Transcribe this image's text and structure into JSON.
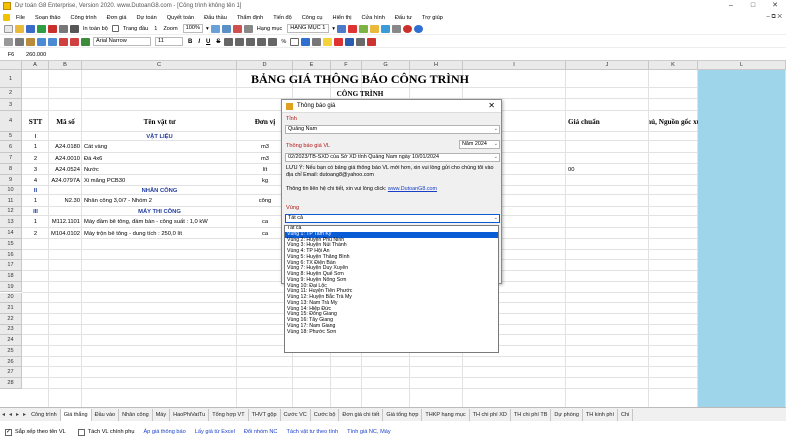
{
  "window": {
    "title": "Dự toán G8 Enterprise, Version 2020.  www.DutoanG8.com - [Công trình không tên 1]",
    "controls": [
      "–",
      "□",
      "✕"
    ]
  },
  "menu": {
    "items": [
      "File",
      "Soạn thảo",
      "Công trình",
      "Đơn giá",
      "Dự toán",
      "Quyết toán",
      "Đấu thầu",
      "Thẩm định",
      "Tiến độ",
      "Công cụ",
      "Hiển thị",
      "Cửa hình",
      "Đấu tư",
      "Trợ giúp"
    ],
    "right_controls": "–  ⧉  ✕"
  },
  "toolbar1": {
    "print_all": "In toàn bộ",
    "page_label": "Trang đầu",
    "page_value": "1",
    "zoom_label": "Zoom",
    "zoom_value": "100%",
    "category_label": "Hạng mục",
    "category_value": "HẠNG MỤC 1"
  },
  "toolbar2": {
    "font_name": "Arial Narrow",
    "font_size": "11",
    "bold": "B",
    "italic": "I",
    "underline": "U",
    "strike": "S",
    "percent": "%"
  },
  "formula": {
    "cell_ref": "F6",
    "value": "260.000"
  },
  "columns": [
    "A",
    "B",
    "C",
    "D",
    "E",
    "F",
    "G",
    "H",
    "I",
    "J",
    "K",
    "L"
  ],
  "rows_numbers": [
    "1",
    "2",
    "3",
    "4",
    "5",
    "6",
    "7",
    "8",
    "9",
    "10",
    "11",
    "12",
    "13",
    "14",
    "15",
    "16",
    "17",
    "18",
    "19",
    "20",
    "21",
    "22",
    "23",
    "24",
    "25",
    "26",
    "27",
    "28"
  ],
  "sheet": {
    "title": "BẢNG GIÁ THÔNG BÁO CÔNG TRÌNH",
    "subtitle": "CÔNG TRÌNH",
    "headers": {
      "stt": "STT",
      "ma_so": "Mã số",
      "ten": "Tên vật tư",
      "don_vi": "Đơn vị",
      "gia_chuan": "Giá chuẩn",
      "ghi_chu": "Ghi chú, Nguồn gốc xuất xứ"
    },
    "rows": [
      {
        "stt": "I",
        "ma": "",
        "ten": "VẬT LIỆU",
        "dv": "",
        "group": true
      },
      {
        "stt": "1",
        "ma": "A24.0180",
        "ten": "Cát vàng",
        "dv": "m3",
        "group": false
      },
      {
        "stt": "2",
        "ma": "A24.0010",
        "ten": "Đá 4x6",
        "dv": "m3",
        "group": false
      },
      {
        "stt": "3",
        "ma": "A24.0524",
        "ten": "Nước",
        "dv": "lít",
        "group": false
      },
      {
        "stt": "4",
        "ma": "A24.0797A",
        "ten": "Xi măng PCB30",
        "dv": "kg",
        "group": false
      },
      {
        "stt": "II",
        "ma": "",
        "ten": "NHÂN CÔNG",
        "dv": "",
        "group": true
      },
      {
        "stt": "1",
        "ma": "N2.30",
        "ten": "Nhân công 3,0/7 - Nhóm 2",
        "dv": "công",
        "group": false
      },
      {
        "stt": "III",
        "ma": "",
        "ten": "MÁY THI CÔNG",
        "dv": "",
        "group": true
      },
      {
        "stt": "1",
        "ma": "M112.1101",
        "ten": "Máy đầm bê tông, đầm bàn - công suất : 1,0 kW",
        "dv": "ca",
        "group": false
      },
      {
        "stt": "2",
        "ma": "M104.0102",
        "ten": "Máy trộn bê tông - dung tích : 250,0 lít",
        "dv": "ca",
        "group": false
      }
    ],
    "partial_value_j9": "00"
  },
  "dialog": {
    "title": "Thông báo giá",
    "close": "✕",
    "province_label": "Tỉnh",
    "province_value": "Quảng Nam",
    "notice_label": "Thông báo giá VL",
    "year_value": "Năm 2024",
    "notice_value": "02/2023/TB-SXD của Sở XD tỉnh Quảng Nam ngày 10/01/2024",
    "note": "LƯU Ý: Nếu bạn có bảng giá thông báo VL mới hơn, xin vui lòng gửi cho chúng tôi vào địa chỉ Email:  dutoang8@yahoo.com",
    "info_prefix": "Thông tin liên hệ chi tiết, xin vui lòng click: ",
    "info_link": "www.DutoanG8.com",
    "region_label": "Vùng",
    "region_value": "Tất cả",
    "region_options": [
      "Tất cả",
      "Vùng 1: TP Tam Kỳ",
      "Vùng 2: Huyện Phú Ninh",
      "Vùng 3: Huyện Núi Thành",
      "Vùng 4: TP Hội An",
      "Vùng 5: Huyện Thăng Bình",
      "Vùng 6: TX Điện Bàn",
      "Vùng 7: Huyện Duy Xuyên",
      "Vùng 8: Huyện Quế Sơn",
      "Vùng 9: Huyện Nông Sơn",
      "Vùng 10: Đại Lộc",
      "Vùng 11: Huyện Tiên Phước",
      "Vùng 12: Huyện Bắc Trà My",
      "Vùng 13: Nam Trà My",
      "Vùng 14: Hiệp Đức",
      "Vùng 15: Đông Giang",
      "Vùng 16: Tây Giang",
      "Vùng 17: Nam Giang",
      "Vùng 18: Phước Sơn"
    ],
    "selected_index": 1
  },
  "tabs": {
    "nav": [
      "◂",
      "◂",
      "▸",
      "▸"
    ],
    "items": [
      "Công trình",
      "Giá thắng",
      "Đầu vào",
      "Nhân công",
      "Máy",
      "HaoPhiVatTu",
      "Tổng hợp VT",
      "THVT gộp",
      "Cước VC",
      "Cước bộ",
      "Đơn giá chi tiết",
      "Giá tổng hợp",
      "THKP hạng mục",
      "TH chi phí XD",
      "TH chi phí TB",
      "Dự phòng",
      "TH kinh phí",
      "Chi"
    ],
    "active_index": 1
  },
  "status": {
    "check1": "Sắp xếp theo tên VL",
    "check2": "Tách VL chính phụ",
    "links": [
      "Áp giá thông báo",
      "Lấy giá từ Excel",
      "Đổi nhóm NC",
      "Tách vật tư theo tính",
      "Tính giá NC, Máy"
    ]
  },
  "colors": {
    "accent": "#0a5bd6",
    "panel": "#9fd5ea",
    "group_text": "#1f3a9c",
    "label_red": "#b01818"
  }
}
